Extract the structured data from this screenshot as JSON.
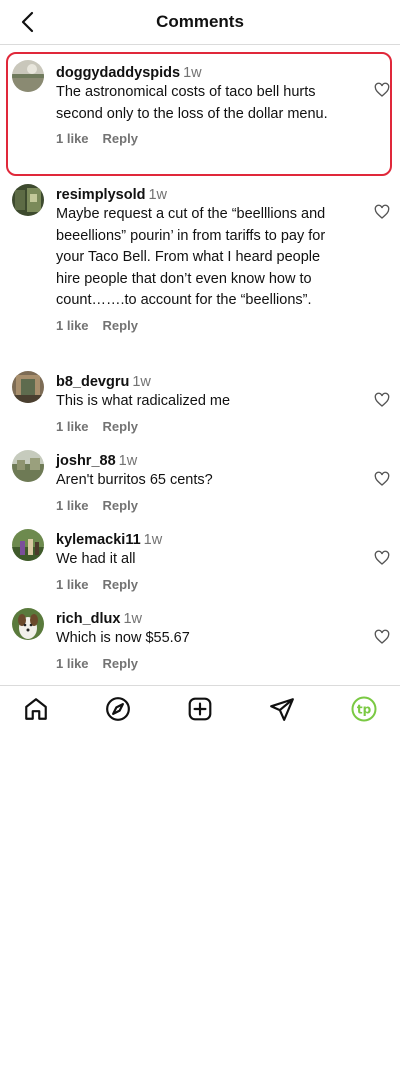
{
  "header": {
    "title": "Comments",
    "back_icon": "chevron-left-icon"
  },
  "comments": [
    {
      "username": "doggydaddyspids",
      "time": "1w",
      "text": "The astronomical costs of taco bell hurts second only to the loss of the dollar menu.",
      "likes": "1 like",
      "reply": "Reply",
      "highlighted": true
    },
    {
      "username": "resimplysold",
      "time": "1w",
      "text": "Maybe request a cut of the “beelllions and beeellions” pourin’ in from tariffs to pay for your Taco Bell. From what I heard people hire people that don’t even know how to count…….to account for the “beellions”.",
      "likes": "1 like",
      "reply": "Reply"
    },
    {
      "username": "b8_devgru",
      "time": "1w",
      "text": "This is what radicalized me",
      "likes": "1 like",
      "reply": "Reply"
    },
    {
      "username": "joshr_88",
      "time": "1w",
      "text": "Aren't burritos 65 cents?",
      "likes": "1 like",
      "reply": "Reply"
    },
    {
      "username": "kylemacki11",
      "time": "1w",
      "text": "We had it all",
      "likes": "1 like",
      "reply": "Reply"
    },
    {
      "username": "rich_dlux",
      "time": "1w",
      "text": "Which is now $55.67",
      "likes": "1 like",
      "reply": "Reply"
    }
  ],
  "colors": {
    "highlight_border": "#e0283a",
    "secondary_text": "#737373",
    "profile_accent": "#7ac943"
  },
  "bottom_nav": {
    "items": [
      "home-icon",
      "explore-icon",
      "create-icon",
      "direct-icon",
      "profile-icon"
    ],
    "profile_initials": "tp"
  }
}
